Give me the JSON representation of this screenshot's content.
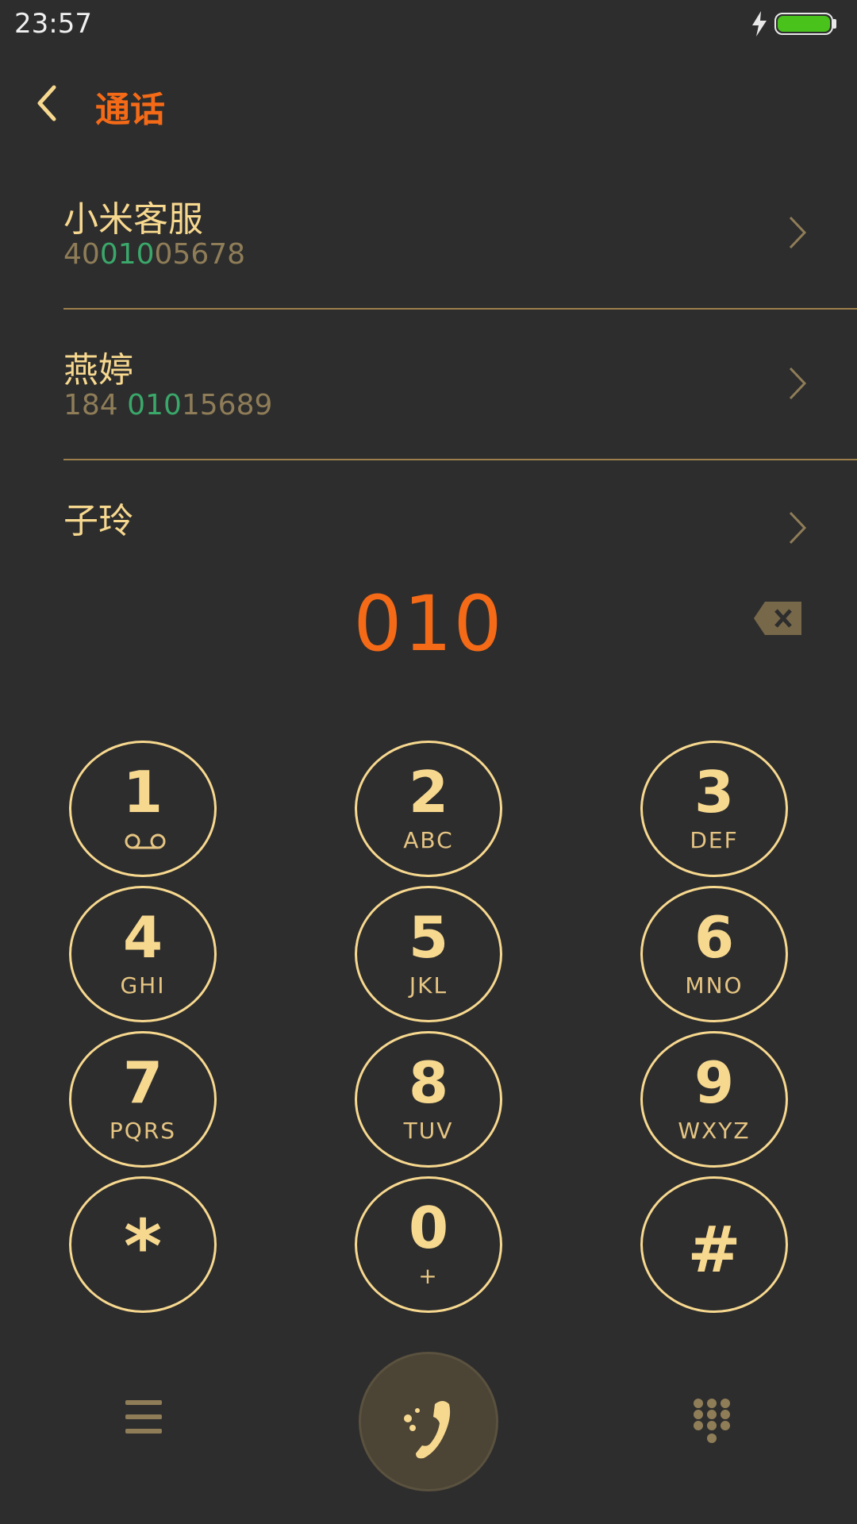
{
  "status_bar": {
    "time": "23:57",
    "charging_icon": "lightning-bolt-icon",
    "battery_level": 1.0,
    "battery_color": "#49c21c"
  },
  "header": {
    "back_icon": "chevron-left-icon",
    "title": "通话"
  },
  "contacts": [
    {
      "name": "小米客服",
      "number_pre": "40",
      "number_match": "010",
      "number_post": "05678"
    },
    {
      "name": "燕婷",
      "number_pre": "184 ",
      "number_match": "010",
      "number_post": "15689"
    },
    {
      "name": "子玲",
      "number_pre": "",
      "number_match": "",
      "number_post": ""
    }
  ],
  "dialed_number": "010",
  "keypad": [
    {
      "digit": "1",
      "letters": ""
    },
    {
      "digit": "2",
      "letters": "ABC"
    },
    {
      "digit": "3",
      "letters": "DEF"
    },
    {
      "digit": "4",
      "letters": "GHI"
    },
    {
      "digit": "5",
      "letters": "JKL"
    },
    {
      "digit": "6",
      "letters": "MNO"
    },
    {
      "digit": "7",
      "letters": "PQRS"
    },
    {
      "digit": "8",
      "letters": "TUV"
    },
    {
      "digit": "9",
      "letters": "WXYZ"
    },
    {
      "digit": "*",
      "letters": ""
    },
    {
      "digit": "0",
      "letters": "+"
    },
    {
      "digit": "#",
      "letters": ""
    }
  ],
  "colors": {
    "background": "#2d2d2d",
    "accent_orange": "#f46a17",
    "gold": "#f7d88f",
    "match_green": "#3aa86a",
    "muted_number": "#8f7d58"
  },
  "icons": {
    "voicemail": "voicemail-icon",
    "backspace": "backspace-icon",
    "menu": "menu-icon",
    "call": "phone-call-icon",
    "keypad_toggle": "dialpad-icon"
  }
}
